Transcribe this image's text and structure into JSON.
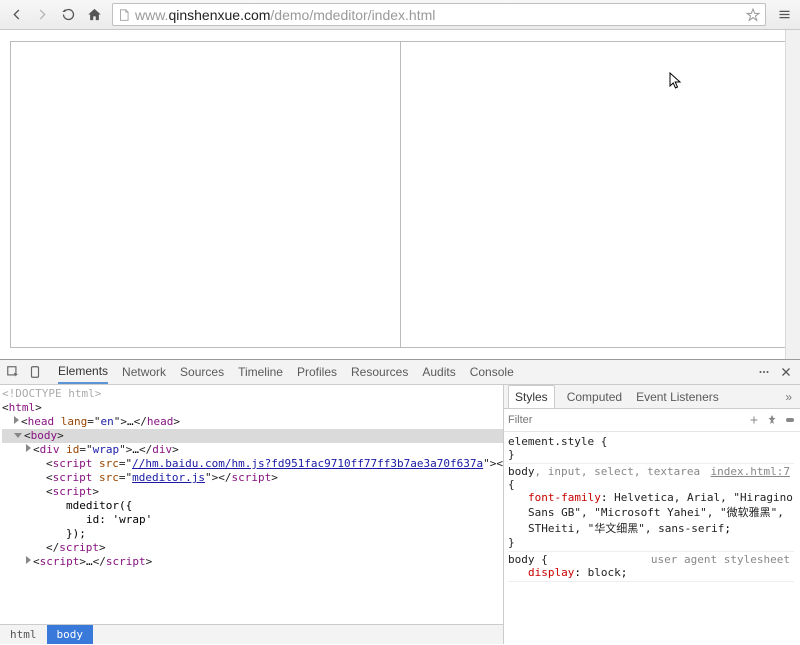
{
  "browser": {
    "url_gray_prefix": "www.",
    "url_host": "qinshenxue.com",
    "url_path": "/demo/mdeditor/index.html"
  },
  "devtools": {
    "tabs": [
      "Elements",
      "Network",
      "Sources",
      "Timeline",
      "Profiles",
      "Resources",
      "Audits",
      "Console"
    ],
    "active_tab": 0
  },
  "dom": {
    "doctype": "<!DOCTYPE html>",
    "html_open": "html",
    "head_open": "head",
    "head_attr_name": "lang",
    "head_attr_val": "en",
    "ellipsis": "…",
    "head_close": "head",
    "body_open": "body",
    "div_open": "div",
    "div_attr_name": "id",
    "div_attr_val": "wrap",
    "div_close": "div",
    "script_open": "script",
    "script_close": "script",
    "src_attr": "src",
    "baidu_src": "//hm.baidu.com/hm.js?fd951fac9710ff77ff3b7ae3a70f637a",
    "mdeditor_src": "mdeditor.js",
    "inline_line1": "mdeditor({",
    "inline_line2": "id: 'wrap'",
    "inline_line3": "});",
    "crumb_html": "html",
    "crumb_body": "body"
  },
  "styles": {
    "tabs": [
      "Styles",
      "Computed",
      "Event Listeners"
    ],
    "filter_placeholder": "Filter",
    "rule1_sel": "element.style",
    "rule2_sel_gray": ", input, select, textarea",
    "rule2_src": "index.html:7",
    "rule2_prop": "font-family",
    "rule2_val": "Helvetica, Arial, \"Hiragino Sans GB\", \"Microsoft Yahei\", \"微软雅黑\", STHeiti, \"华文细黑\", sans-serif",
    "rule3_sel": "body",
    "rule3_src": "user agent stylesheet",
    "rule3_prop": "display",
    "rule3_val": "block",
    "body_kw": "body",
    "brace_open": "{",
    "brace_close": "}"
  }
}
